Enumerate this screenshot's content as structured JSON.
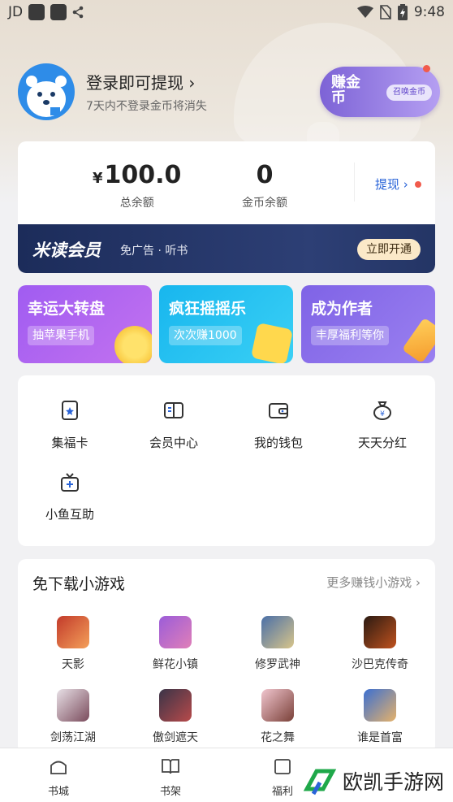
{
  "status_bar": {
    "carrier": "JD",
    "time": "9:48"
  },
  "user": {
    "login_title": "登录即可提现",
    "login_chevron": "›",
    "login_subtitle": "7天内不登录金币将消失",
    "earn_badge_text": "赚金币",
    "earn_badge_pill": "召唤金币"
  },
  "balance": {
    "currency_symbol": "¥",
    "total_value": "100.0",
    "total_label": "总余额",
    "coin_value": "0",
    "coin_label": "金币余额",
    "withdraw_label": "提现 ›"
  },
  "vip": {
    "title": "米读会员",
    "desc": "免广告 · 听书",
    "button": "立即开通"
  },
  "promos": [
    {
      "title": "幸运大转盘",
      "sub": "抽苹果手机"
    },
    {
      "title": "疯狂摇摇乐",
      "sub": "次次赚1000"
    },
    {
      "title": "成为作者",
      "sub": "丰厚福利等你"
    }
  ],
  "features": [
    {
      "label": "集福卡",
      "icon": "card-star-icon"
    },
    {
      "label": "会员中心",
      "icon": "member-book-icon"
    },
    {
      "label": "我的钱包",
      "icon": "wallet-icon"
    },
    {
      "label": "天天分红",
      "icon": "money-bag-icon"
    },
    {
      "label": "小鱼互助",
      "icon": "gift-plus-icon"
    }
  ],
  "games": {
    "title": "免下载小游戏",
    "more": "更多赚钱小游戏 ›",
    "items": [
      {
        "label": "天影"
      },
      {
        "label": "鲜花小镇"
      },
      {
        "label": "修罗武神"
      },
      {
        "label": "沙巴克传奇"
      },
      {
        "label": "剑荡江湖"
      },
      {
        "label": "傲剑遮天"
      },
      {
        "label": "花之舞"
      },
      {
        "label": "谁是首富"
      }
    ]
  },
  "nav": [
    {
      "label": "书城"
    },
    {
      "label": "书架"
    },
    {
      "label": "福利"
    }
  ],
  "watermark": {
    "text": "欧凯手游网"
  },
  "colors": {
    "accent_blue": "#2a64d8",
    "vip_bg": "#1c2c5a",
    "red_dot": "#f15b4c"
  }
}
